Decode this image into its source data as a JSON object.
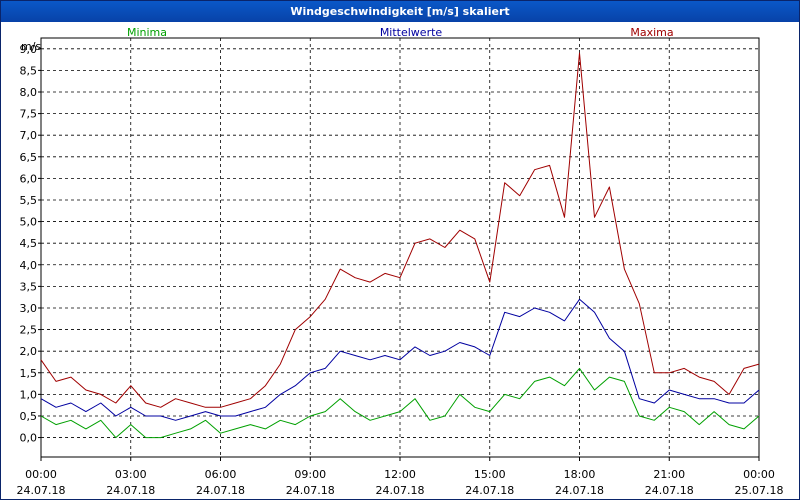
{
  "window": {
    "title": "Windgeschwindigkeit [m/s] skaliert"
  },
  "colors": {
    "minima": "#00a000",
    "mittel": "#0000a0",
    "maxima": "#a00000",
    "grid": "#000000"
  },
  "chart_data": {
    "type": "line",
    "title": "Windgeschwindigkeit [m/s] skaliert",
    "ylabel": "m/s",
    "ylim": [
      -0.45,
      9.25
    ],
    "xlim": [
      0,
      24
    ],
    "grid": true,
    "legend_position": "top",
    "y_ticks": [
      "0,0",
      "0,5",
      "1,0",
      "1,5",
      "2,0",
      "2,5",
      "3,0",
      "3,5",
      "4,0",
      "4,5",
      "5,0",
      "5,5",
      "6,0",
      "6,5",
      "7,0",
      "7,5",
      "8,0",
      "8,5",
      "9,0"
    ],
    "x_ticks": [
      {
        "time": "00:00",
        "date": "24.07.18"
      },
      {
        "time": "03:00",
        "date": "24.07.18"
      },
      {
        "time": "06:00",
        "date": "24.07.18"
      },
      {
        "time": "09:00",
        "date": "24.07.18"
      },
      {
        "time": "12:00",
        "date": "24.07.18"
      },
      {
        "time": "15:00",
        "date": "24.07.18"
      },
      {
        "time": "18:00",
        "date": "24.07.18"
      },
      {
        "time": "21:00",
        "date": "24.07.18"
      },
      {
        "time": "00:00",
        "date": "25.07.18"
      }
    ],
    "series": [
      {
        "name": "Minima",
        "x": [
          0,
          0.5,
          1,
          1.5,
          2,
          2.5,
          3,
          3.5,
          4,
          4.5,
          5,
          5.5,
          6,
          6.5,
          7,
          7.5,
          8,
          8.5,
          9,
          9.5,
          10,
          10.5,
          11,
          11.5,
          12,
          12.5,
          13,
          13.5,
          14,
          14.5,
          15,
          15.5,
          16,
          16.5,
          17,
          17.5,
          18,
          18.5,
          19,
          19.5,
          20,
          20.5,
          21,
          21.5,
          22,
          22.5,
          23,
          23.5,
          24
        ],
        "values": [
          0.5,
          0.3,
          0.4,
          0.2,
          0.4,
          0,
          0.3,
          0,
          0,
          0.1,
          0.2,
          0.4,
          0.1,
          0.2,
          0.3,
          0.2,
          0.4,
          0.3,
          0.5,
          0.6,
          0.9,
          0.6,
          0.4,
          0.5,
          0.6,
          0.9,
          0.4,
          0.5,
          1.0,
          0.7,
          0.6,
          1.0,
          0.9,
          1.3,
          1.4,
          1.2,
          1.6,
          1.1,
          1.4,
          1.3,
          0.5,
          0.4,
          0.7,
          0.6,
          0.3,
          0.6,
          0.3,
          0.2,
          0.5
        ]
      },
      {
        "name": "Mittelwerte",
        "x": [
          0,
          0.5,
          1,
          1.5,
          2,
          2.5,
          3,
          3.5,
          4,
          4.5,
          5,
          5.5,
          6,
          6.5,
          7,
          7.5,
          8,
          8.5,
          9,
          9.5,
          10,
          10.5,
          11,
          11.5,
          12,
          12.5,
          13,
          13.5,
          14,
          14.5,
          15,
          15.5,
          16,
          16.5,
          17,
          17.5,
          18,
          18.5,
          19,
          19.5,
          20,
          20.5,
          21,
          21.5,
          22,
          22.5,
          23,
          23.5,
          24
        ],
        "values": [
          0.9,
          0.7,
          0.8,
          0.6,
          0.8,
          0.5,
          0.7,
          0.5,
          0.5,
          0.4,
          0.5,
          0.6,
          0.5,
          0.5,
          0.6,
          0.7,
          1.0,
          1.2,
          1.5,
          1.6,
          2.0,
          1.9,
          1.8,
          1.9,
          1.8,
          2.1,
          1.9,
          2.0,
          2.2,
          2.1,
          1.9,
          2.9,
          2.8,
          3.0,
          2.9,
          2.7,
          3.2,
          2.9,
          2.3,
          2.0,
          0.9,
          0.8,
          1.1,
          1.0,
          0.9,
          0.9,
          0.8,
          0.8,
          1.1
        ]
      },
      {
        "name": "Maxima",
        "x": [
          0,
          0.5,
          1,
          1.5,
          2,
          2.5,
          3,
          3.5,
          4,
          4.5,
          5,
          5.5,
          6,
          6.5,
          7,
          7.5,
          8,
          8.5,
          9,
          9.5,
          10,
          10.5,
          11,
          11.5,
          12,
          12.5,
          13,
          13.5,
          14,
          14.5,
          15,
          15.5,
          16,
          16.5,
          17,
          17.5,
          18,
          18.5,
          19,
          19.5,
          20,
          20.5,
          21,
          21.5,
          22,
          22.5,
          23,
          23.5,
          24
        ],
        "values": [
          1.8,
          1.3,
          1.4,
          1.1,
          1.0,
          0.8,
          1.2,
          0.8,
          0.7,
          0.9,
          0.8,
          0.7,
          0.7,
          0.8,
          0.9,
          1.2,
          1.7,
          2.5,
          2.8,
          3.2,
          3.9,
          3.7,
          3.6,
          3.8,
          3.7,
          4.5,
          4.6,
          4.4,
          4.8,
          4.6,
          3.6,
          5.9,
          5.6,
          6.2,
          6.3,
          5.1,
          8.9,
          5.1,
          5.8,
          3.9,
          3.1,
          1.5,
          1.5,
          1.6,
          1.4,
          1.3,
          1.0,
          1.6,
          1.7
        ]
      }
    ]
  }
}
